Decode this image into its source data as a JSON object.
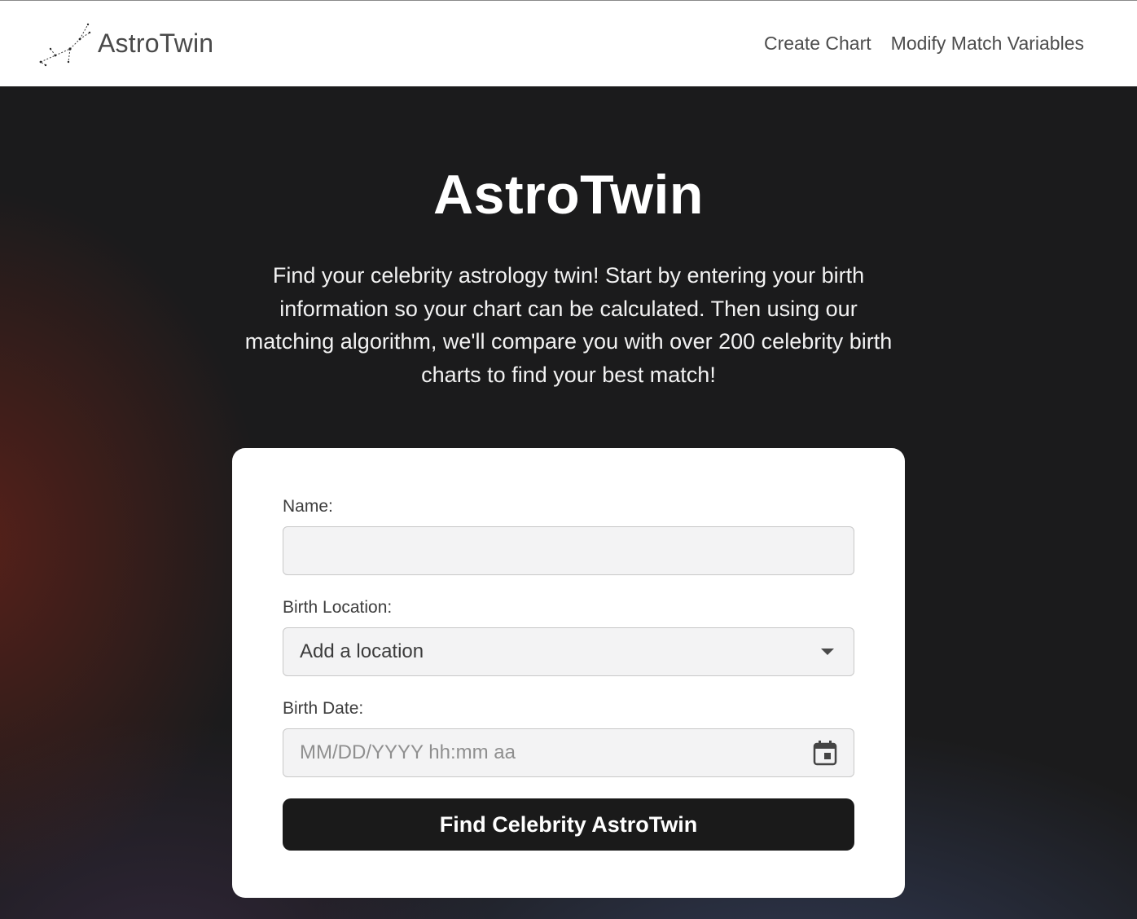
{
  "header": {
    "brand_name": "AstroTwin",
    "logo_icon": "constellation-icon",
    "nav": [
      {
        "label": "Create Chart"
      },
      {
        "label": "Modify Match Variables"
      }
    ]
  },
  "hero": {
    "title": "AstroTwin",
    "description": "Find your celebrity astrology twin! Start by entering your birth information so your chart can be calculated. Then using our matching algorithm, we'll compare you with over 200 celebrity birth charts to find your best match!"
  },
  "form": {
    "name_label": "Name:",
    "name_value": "",
    "location_label": "Birth Location:",
    "location_value": "Add a location",
    "date_label": "Birth Date:",
    "date_placeholder": "MM/DD/YYYY hh:mm aa",
    "submit_label": "Find Celebrity AstroTwin"
  },
  "colors": {
    "accent": "#1a1a1a",
    "card": "#ffffff",
    "hero_base": "#1b1b1c"
  }
}
